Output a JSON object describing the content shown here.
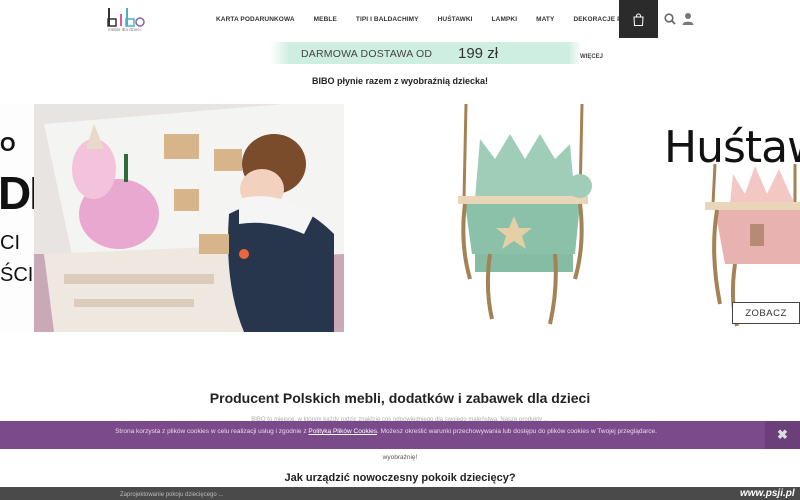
{
  "header": {
    "logo_text": "meble dla dzieci",
    "nav": [
      {
        "label": "KARTA PODARUNKOWA"
      },
      {
        "label": "MEBLE"
      },
      {
        "label": "TIPI I BALDACHIMY"
      },
      {
        "label": "HUŚTAWKI"
      },
      {
        "label": "LAMPKI"
      },
      {
        "label": "MATY"
      },
      {
        "label": "DEKORACJE POKOJU"
      }
    ],
    "icons": {
      "cart": "shopping-bag-icon",
      "search": "search-icon",
      "user": "user-icon"
    }
  },
  "promo": {
    "text": "DARMOWA DOSTAWA OD",
    "price": "199 zł",
    "more": "WIĘCEJ"
  },
  "tagline": "BIBO płynie razem z wyobraźnią dziecka!",
  "slider": {
    "left_letters": [
      "O",
      "DE",
      "CI",
      "ŚCI"
    ],
    "swing_title": "Huśtaw",
    "cta": "ZOBACZ"
  },
  "content": {
    "title": "Producent Polskich mebli, dodatków i zabawek dla dzieci",
    "blurred_line": "BIBO to miejsce, w którym każdy rodzic znajdzie coś odpowiedniego dla swojego maleństwa. Nasze produkty ... ",
    "continuation": "wyobraźnię!",
    "subtitle": "Jak urządzić nowoczesny pokoik dziecięcy?",
    "bottom_blurred": "Zaprojektowanie pokoju dziecięcego ..."
  },
  "cookie": {
    "text_before": "Strona korzysta z plików cookies w celu realizacji usług i zgodnie z",
    "link": "Polityką Plików Cookies",
    "text_after": ". Możesz określić warunki przechowywania lub dostępu do plików cookies w Twojej przeglądarce.",
    "close": "✖"
  },
  "watermark": "www.psji.pl",
  "colors": {
    "cookie_bg": "#7a4a8a",
    "promo_bg": "#cdeee0",
    "cart_bg": "#2b2b2b"
  }
}
